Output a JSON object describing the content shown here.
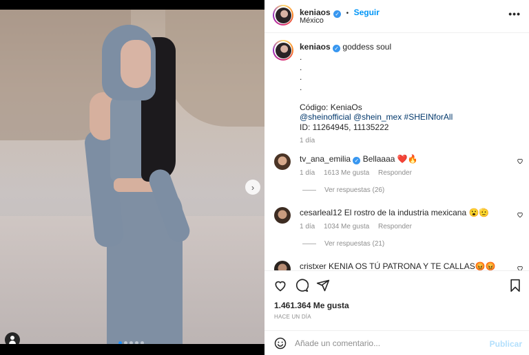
{
  "post": {
    "username": "keniaos",
    "follow_label": "Seguir",
    "separator": "•",
    "location": "México",
    "more_label": "•••"
  },
  "caption": {
    "username": "keniaos",
    "text": "goddess soul",
    "body": ".\n.\n.\n.\n\nCódigo: KeniaOs",
    "links": "@sheinofficial @shein_mex #SHEINforAll",
    "ids": "ID: 11264945, 11135222",
    "time": "1 día"
  },
  "comments": [
    {
      "username": "tv_ana_emilia",
      "text": "Bellaaaa ❤️🔥",
      "time": "1 día",
      "likes": "1613 Me gusta",
      "reply_label": "Responder",
      "view_replies": "Ver respuestas (26)"
    },
    {
      "username": "cesarleal12",
      "text": "El rostro de la industria mexicana 😮🫡",
      "time": "1 día",
      "likes": "1034 Me gusta",
      "reply_label": "Responder",
      "view_replies": "Ver respuestas (21)"
    },
    {
      "username": "cristxer",
      "text": "KENIA OS TÚ PATRONA Y TE CALLAS😡😡"
    }
  ],
  "stats": {
    "likes": "1.461.364 Me gusta",
    "posted": "HACE UN DÍA"
  },
  "add_comment": {
    "placeholder": "Añade un comentario...",
    "publish_label": "Publicar"
  },
  "carousel": {
    "total": 5,
    "active": 1
  },
  "colors": {
    "accent": "#0095f6",
    "verified": "#3897f0",
    "publish_disabled": "#b2dffc"
  },
  "icons": [
    "next-arrow-icon",
    "user-tag-icon",
    "more-options-icon",
    "verified-icon",
    "heart-icon",
    "comment-icon",
    "share-icon",
    "bookmark-icon",
    "emoji-icon"
  ]
}
